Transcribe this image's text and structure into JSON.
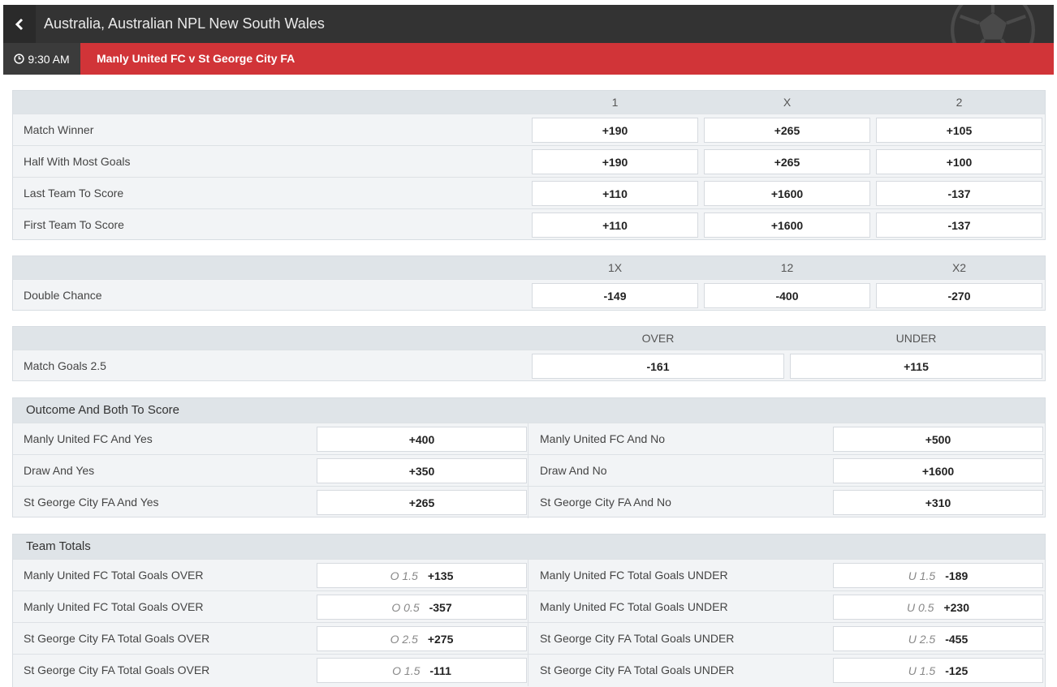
{
  "header": {
    "league_title": "Australia, Australian NPL New South Wales",
    "match_time": "9:30 AM",
    "match_name": "Manly United FC v St George City FA"
  },
  "markets": {
    "three_way": {
      "columns": [
        "1",
        "X",
        "2"
      ],
      "rows": [
        {
          "label": "Match Winner",
          "odds": [
            "+190",
            "+265",
            "+105"
          ]
        },
        {
          "label": "Half With Most Goals",
          "odds": [
            "+190",
            "+265",
            "+100"
          ]
        },
        {
          "label": "Last Team To Score",
          "odds": [
            "+110",
            "+1600",
            "-137"
          ]
        },
        {
          "label": "First Team To Score",
          "odds": [
            "+110",
            "+1600",
            "-137"
          ]
        }
      ]
    },
    "double_chance": {
      "columns": [
        "1X",
        "12",
        "X2"
      ],
      "rows": [
        {
          "label": "Double Chance",
          "odds": [
            "-149",
            "-400",
            "-270"
          ]
        }
      ]
    },
    "match_goals": {
      "columns": [
        "OVER",
        "UNDER"
      ],
      "rows": [
        {
          "label": "Match Goals 2.5",
          "odds": [
            "-161",
            "+115"
          ]
        }
      ]
    },
    "outcome_both": {
      "title": "Outcome And Both To Score",
      "rows": [
        {
          "left_label": "Manly United FC And Yes",
          "left_odd": "+400",
          "right_label": "Manly United FC And No",
          "right_odd": "+500"
        },
        {
          "left_label": "Draw And Yes",
          "left_odd": "+350",
          "right_label": "Draw And No",
          "right_odd": "+1600"
        },
        {
          "left_label": "St George City FA And Yes",
          "left_odd": "+265",
          "right_label": "St George City FA And No",
          "right_odd": "+310"
        }
      ]
    },
    "team_totals": {
      "title": "Team Totals",
      "rows": [
        {
          "left_label": "Manly United FC Total Goals OVER",
          "left_line": "O 1.5",
          "left_odd": "+135",
          "right_label": "Manly United FC Total Goals UNDER",
          "right_line": "U 1.5",
          "right_odd": "-189"
        },
        {
          "left_label": "Manly United FC Total Goals OVER",
          "left_line": "O 0.5",
          "left_odd": "-357",
          "right_label": "Manly United FC Total Goals UNDER",
          "right_line": "U 0.5",
          "right_odd": "+230"
        },
        {
          "left_label": "St George City FA Total Goals OVER",
          "left_line": "O 2.5",
          "left_odd": "+275",
          "right_label": "St George City FA Total Goals UNDER",
          "right_line": "U 2.5",
          "right_odd": "-455"
        },
        {
          "left_label": "St George City FA Total Goals OVER",
          "left_line": "O 1.5",
          "left_odd": "-111",
          "right_label": "St George City FA Total Goals UNDER",
          "right_line": "U 1.5",
          "right_odd": "-125"
        }
      ]
    }
  },
  "colors": {
    "topbar": "#333333",
    "matchbar": "#d13438",
    "time_box": "#3b3b3b"
  }
}
